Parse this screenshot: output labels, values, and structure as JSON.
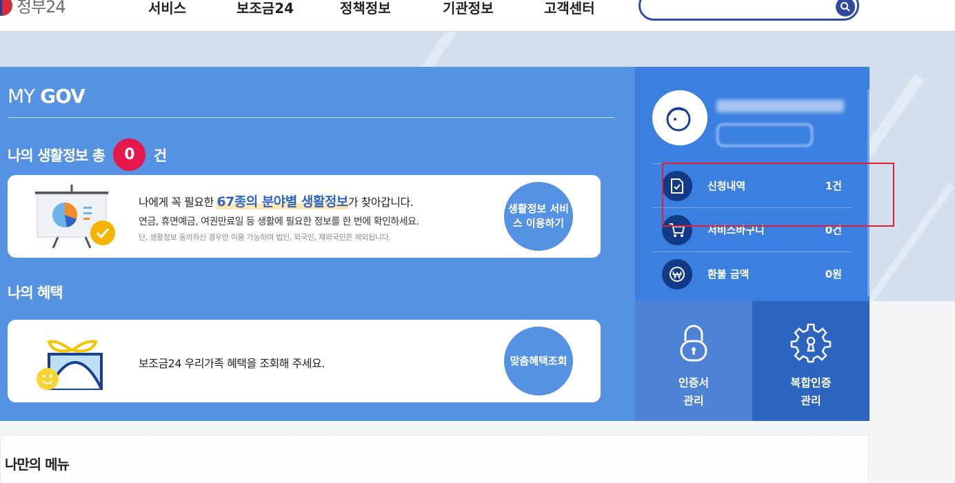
{
  "header": {
    "logo_text": "정부24",
    "nav": [
      "서비스",
      "보조금24",
      "정책정보",
      "기관정보",
      "고객센터"
    ],
    "search_placeholder": ""
  },
  "mygov": {
    "title_prefix": "MY ",
    "title_bold": "GOV",
    "life_info": {
      "heading_prefix": "나의 생활정보 총",
      "count": "0",
      "unit": "건",
      "main_pre": "나에게 꼭 필요한 ",
      "main_highlight": "67종의 분야별 생활정보",
      "main_post": "가 찾아갑니다.",
      "sub": "연금, 휴면예금, 여권만료일 등 생활에 필요한 정보를 한 번에 확인하세요.",
      "note": "단, 생활정보 동의하신 경우만 이용 가능하며 법인, 외국인, 재외국민은 제외됩니다.",
      "button": "생활정보 서비스 이용하기"
    },
    "benefit": {
      "heading": "나의 혜택",
      "text": "보조금24 우리가족 혜택을 조회해 주세요.",
      "button": "맞춤혜택조회"
    }
  },
  "side": {
    "rows": [
      {
        "label": "신청내역",
        "value": "1건",
        "icon": "document-check-icon"
      },
      {
        "label": "서비스바구니",
        "value": "0건",
        "icon": "cart-icon"
      },
      {
        "label": "환불 금액",
        "value": "0원",
        "icon": "won-icon"
      }
    ],
    "cert": {
      "line1": "인증서",
      "line2": "관리"
    },
    "multi": {
      "line1": "복합인증",
      "line2": "관리"
    }
  },
  "mymenu": {
    "title": "나만의 메뉴"
  },
  "colors": {
    "primary_blue": "#5592e2",
    "side_blue": "#3b7fe0",
    "badge_red": "#e6174b",
    "highlight_red": "#e21d2f"
  }
}
